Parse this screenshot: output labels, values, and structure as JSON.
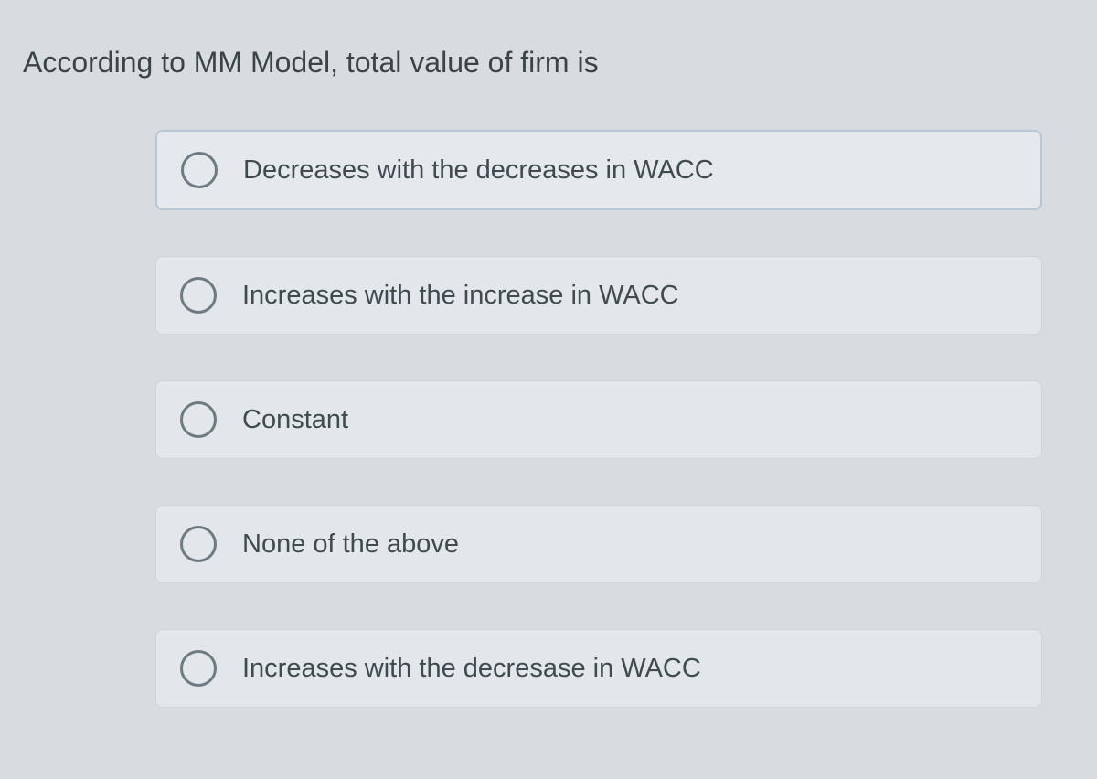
{
  "question": {
    "prompt": "According to MM Model, total value of firm is",
    "options": [
      {
        "label": "Decreases with the decreases in WACC",
        "highlighted": true
      },
      {
        "label": "Increases with the increase in WACC",
        "highlighted": false
      },
      {
        "label": "Constant",
        "highlighted": false
      },
      {
        "label": "None of the above",
        "highlighted": false
      },
      {
        "label": "Increases with the decresase in WACC",
        "highlighted": false
      }
    ]
  }
}
